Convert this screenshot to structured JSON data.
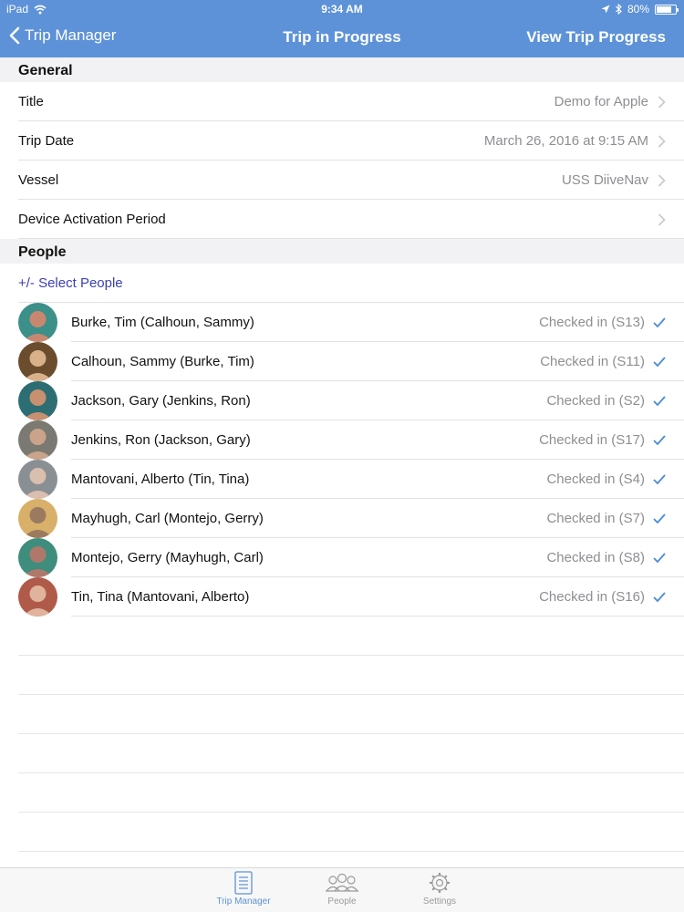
{
  "status": {
    "device": "iPad",
    "time": "9:34 AM",
    "battery": "80%",
    "battery_level": 0.8
  },
  "nav": {
    "back_label": "Trip Manager",
    "title": "Trip in Progress",
    "right_label": "View Trip Progress"
  },
  "general": {
    "header": "General",
    "rows": [
      {
        "label": "Title",
        "value": "Demo for Apple"
      },
      {
        "label": "Trip Date",
        "value": "March 26, 2016 at 9:15 AM"
      },
      {
        "label": "Vessel",
        "value": "USS DiiveNav"
      },
      {
        "label": "Device Activation Period",
        "value": ""
      }
    ]
  },
  "people": {
    "header": "People",
    "select_label": "+/- Select People",
    "items": [
      {
        "name": "Burke, Tim (Calhoun, Sammy)",
        "status": "Checked in (S13)"
      },
      {
        "name": "Calhoun, Sammy (Burke, Tim)",
        "status": "Checked in (S11)"
      },
      {
        "name": "Jackson, Gary (Jenkins, Ron)",
        "status": "Checked in (S2)"
      },
      {
        "name": "Jenkins, Ron (Jackson, Gary)",
        "status": "Checked in (S17)"
      },
      {
        "name": "Mantovani, Alberto (Tin, Tina)",
        "status": "Checked in (S4)"
      },
      {
        "name": "Mayhugh, Carl (Montejo, Gerry)",
        "status": "Checked in (S7)"
      },
      {
        "name": "Montejo, Gerry (Mayhugh, Carl)",
        "status": "Checked in (S8)"
      },
      {
        "name": "Tin, Tina (Mantovani, Alberto)",
        "status": "Checked in (S16)"
      }
    ]
  },
  "tabs": [
    {
      "label": "Trip Manager",
      "icon": "list-document-icon",
      "active": true
    },
    {
      "label": "People",
      "icon": "people-icon",
      "active": false
    },
    {
      "label": "Settings",
      "icon": "gear-icon",
      "active": false
    }
  ],
  "colors": {
    "accent": "#5d92d8",
    "link": "#3b3fb3",
    "secondary_text": "#8e8e93"
  }
}
